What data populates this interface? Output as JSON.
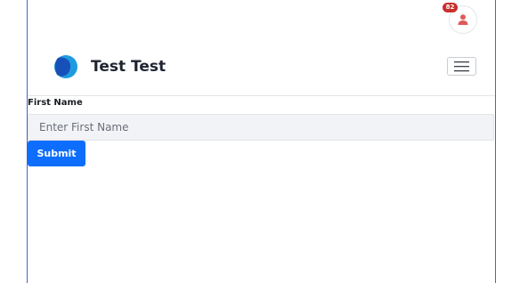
{
  "header": {
    "notification_count": "82",
    "user_icon": "user-icon",
    "brand_name": "Test Test",
    "brand_logo": "logo",
    "menu_icon": "hamburger-menu-icon"
  },
  "form": {
    "first_name_label": "First Name",
    "first_name_placeholder": "Enter First Name",
    "first_name_value": "",
    "submit_label": "Submit"
  },
  "colors": {
    "accent": "#0d6efd",
    "badge": "#c9302c",
    "user_icon": "#e05a5a",
    "frame_border": "#3f67c4"
  }
}
